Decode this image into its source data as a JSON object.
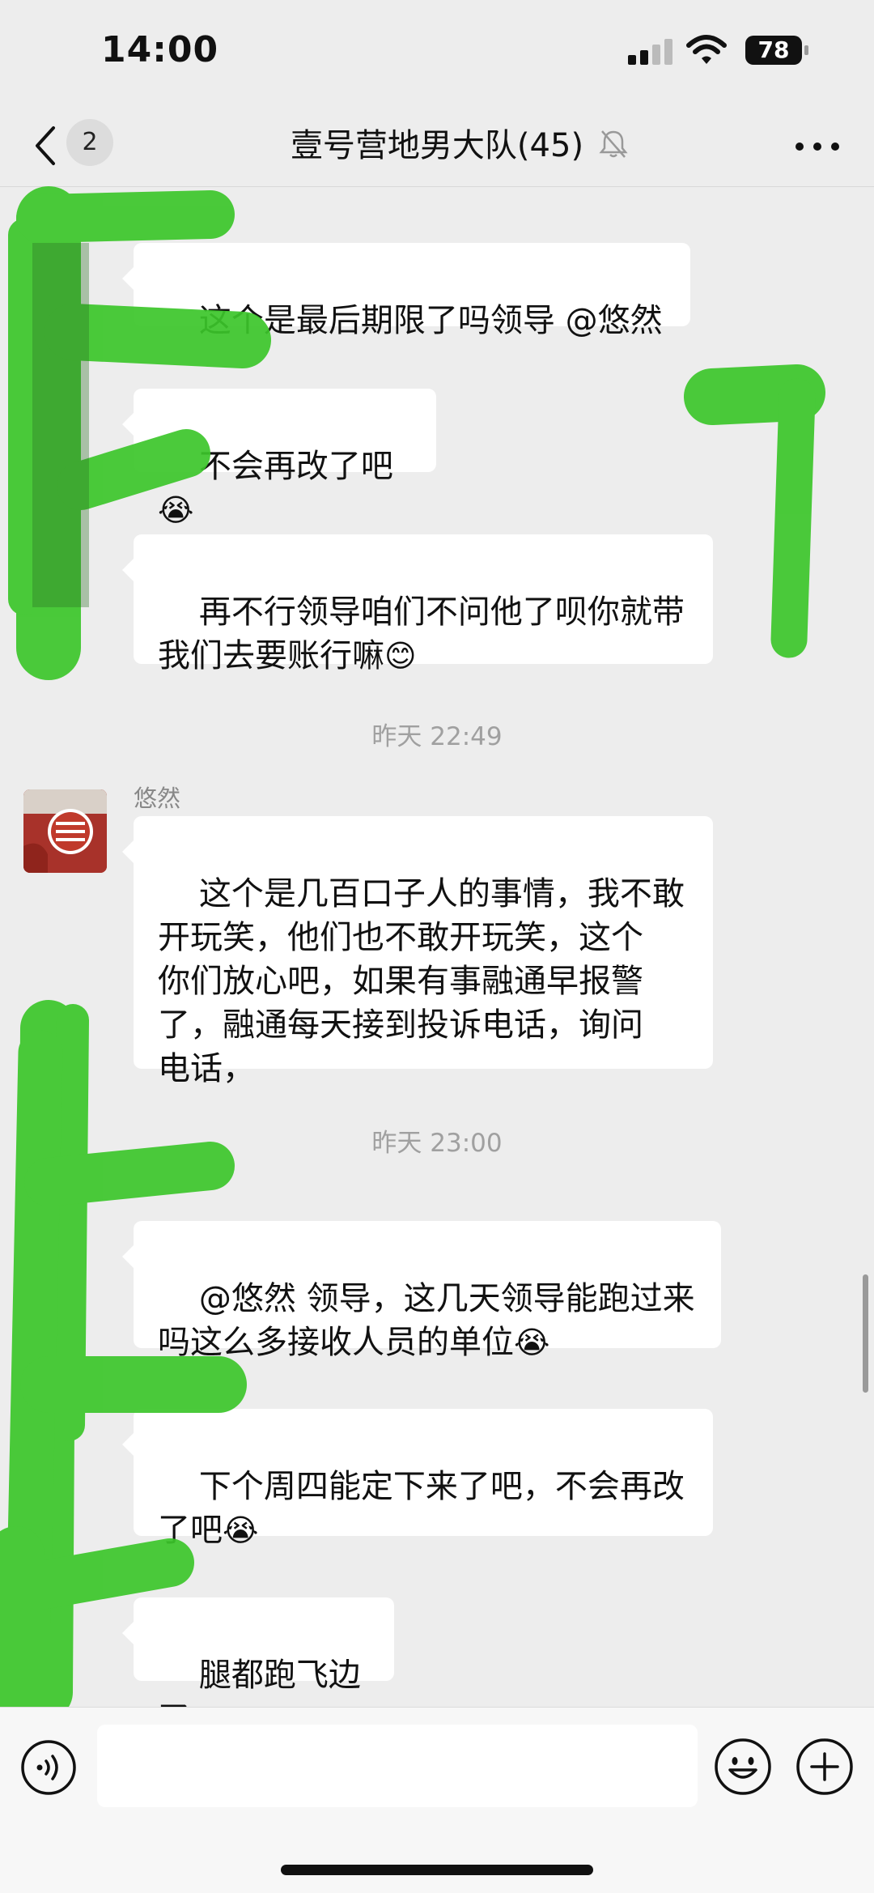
{
  "status_bar": {
    "time": "14:00",
    "battery": "78"
  },
  "nav": {
    "unread_count": "2",
    "title": "壹号营地男大队(45)",
    "back_icon": "chevron-left-icon",
    "mute_icon": "bell-muted-icon",
    "more_icon": "more-dots-icon"
  },
  "messages": [
    {
      "text": "这个是最后期限了吗领导 @悠然"
    },
    {
      "text": "不会再改了吧",
      "emoji": "😭"
    },
    {
      "text": "再不行领导咱们不问他了呗你就带\n我们去要账行嘛",
      "emoji": "😊"
    },
    {
      "text": "这个是几百口子人的事情，我不敢\n开玩笑，他们也不敢开玩笑，这个\n你们放心吧，如果有事融通早报警\n了，融通每天接到投诉电话，询问\n电话，",
      "sender": "悠然"
    },
    {
      "text": "@悠然 领导，这几天领导能跑过来\n吗这么多接收人员的单位",
      "emoji": "😭"
    },
    {
      "text": "下个周四能定下来了吧，不会再改\n了吧",
      "emoji": "😭"
    },
    {
      "text": "腿都跑飞边了"
    }
  ],
  "timestamps": [
    "昨天 22:49",
    "昨天 23:00"
  ],
  "input_bar": {
    "voice_icon": "voice-icon",
    "emoji_icon": "emoji-icon",
    "add_icon": "plus-circle-icon"
  },
  "colors": {
    "background": "#ededed",
    "bubble": "#ffffff",
    "scribble": "#3cc62a"
  }
}
